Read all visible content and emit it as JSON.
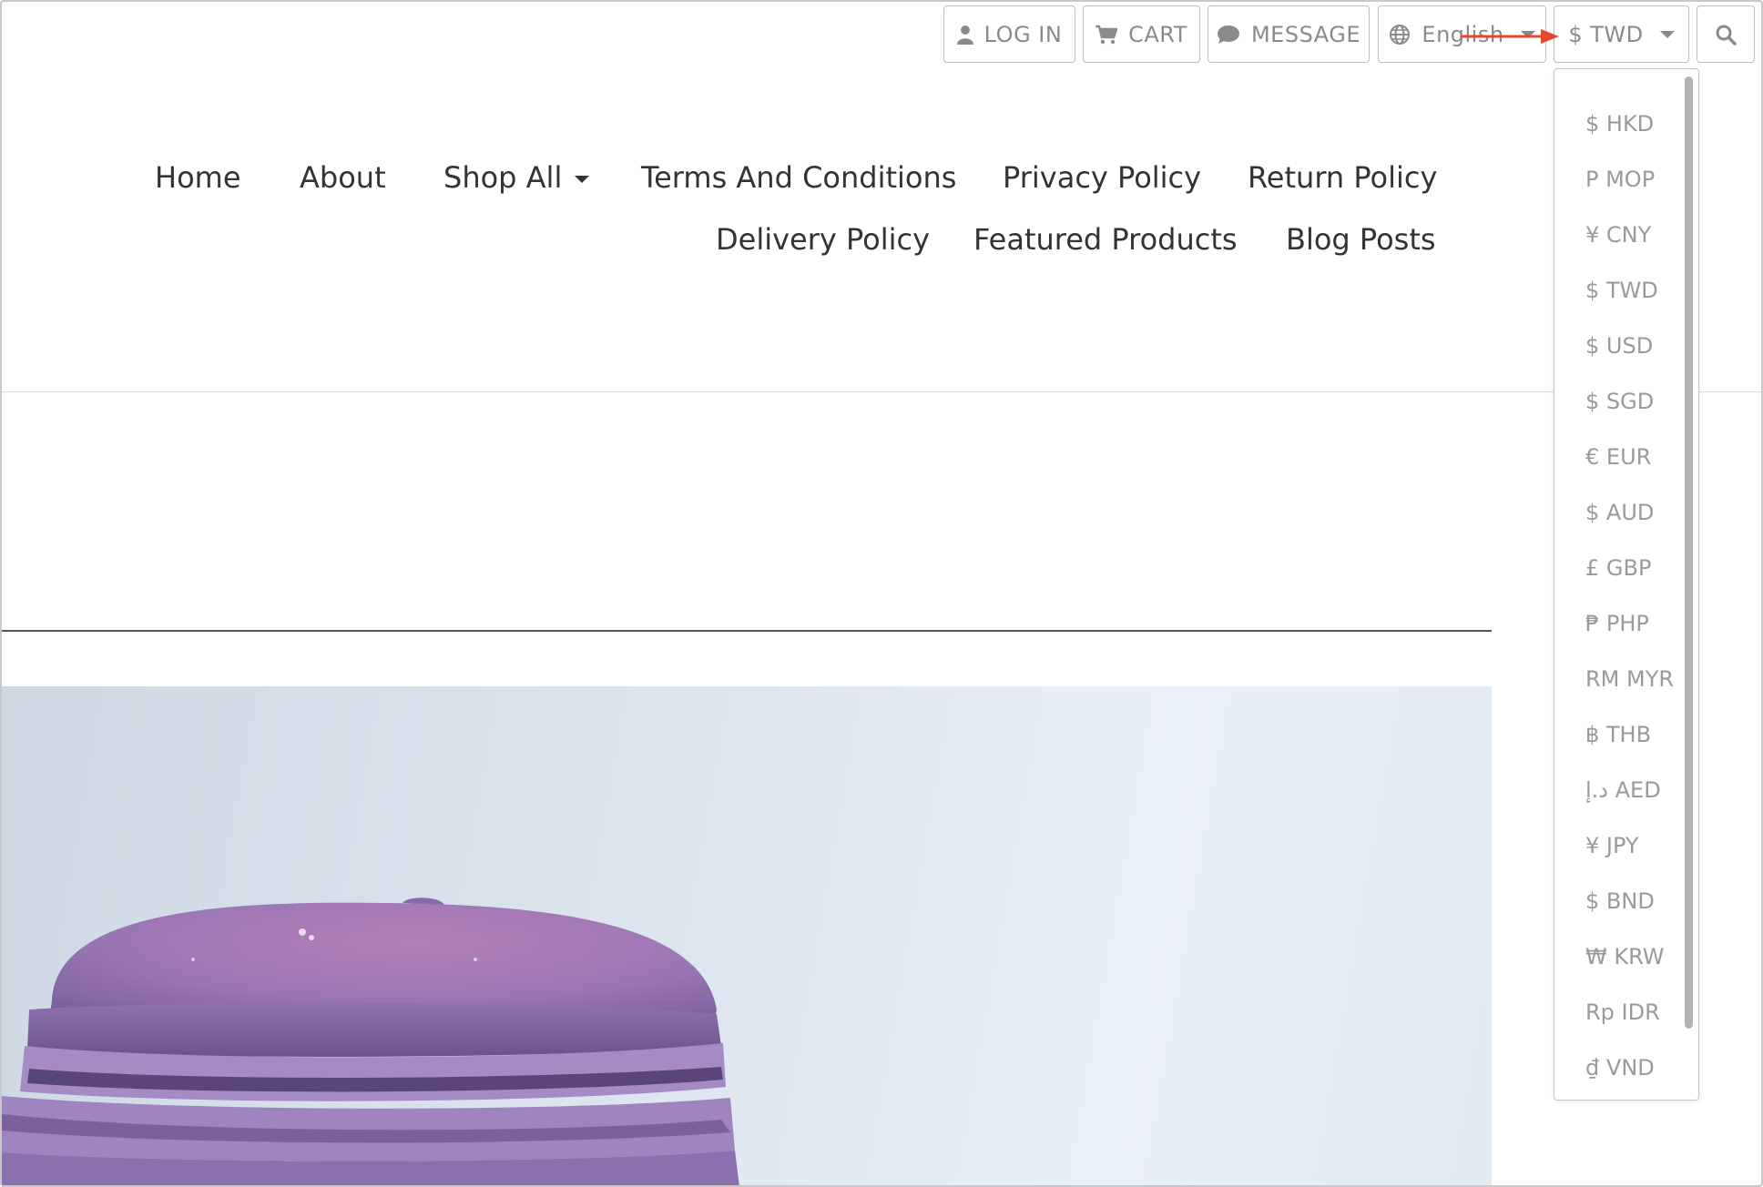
{
  "topbar": {
    "login": "LOG IN",
    "cart": "CART",
    "message": "MESSAGE",
    "language": "English",
    "currency": "$ TWD"
  },
  "nav": {
    "items": [
      "Home",
      "About",
      "Shop All",
      "Terms And Conditions",
      "Privacy Policy",
      "Return Policy",
      "Delivery Policy",
      "Featured Products",
      "Blog Posts"
    ]
  },
  "currency_menu": {
    "options": [
      "$ HKD",
      "P MOP",
      "¥ CNY",
      "$ TWD",
      "$ USD",
      "$ SGD",
      "€ EUR",
      "$ AUD",
      "£ GBP",
      "₱ PHP",
      "RM MYR",
      "฿ THB",
      "د.إ AED",
      "¥ JPY",
      "$ BND",
      "₩ KRW",
      "Rp IDR",
      "₫ VND"
    ]
  },
  "icons": {
    "login": "user-icon",
    "cart": "cart-icon",
    "message": "chat-bubble-icon",
    "language": "globe-icon",
    "search": "search-icon"
  },
  "colors": {
    "annotation_arrow": "#e8472f",
    "hero_background": "#dde5ee",
    "macaron": "#9b7bb5"
  }
}
